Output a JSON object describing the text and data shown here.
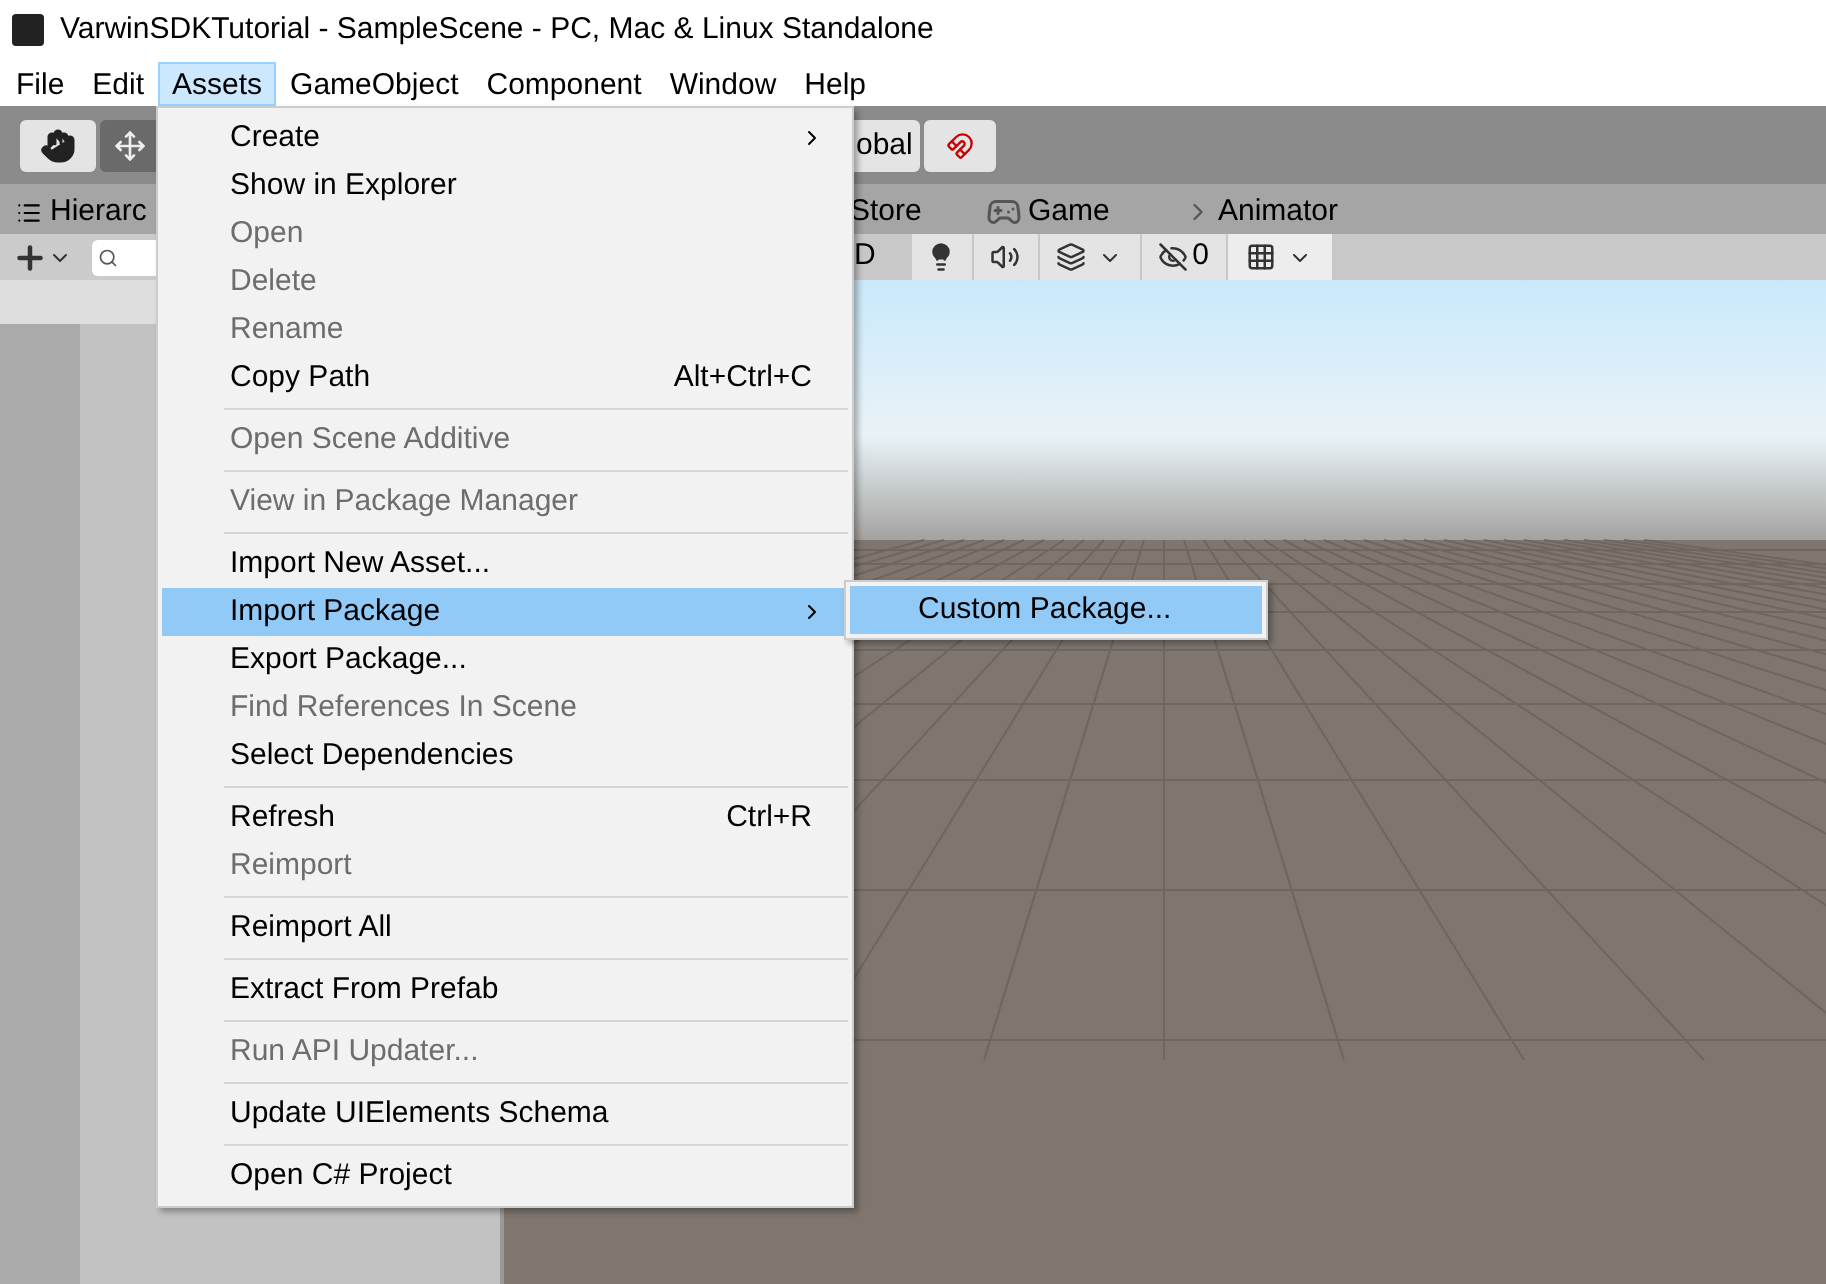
{
  "window": {
    "title": "VarwinSDKTutorial - SampleScene - PC, Mac & Linux Standalone"
  },
  "menubar": [
    {
      "label": "File",
      "selected": false
    },
    {
      "label": "Edit",
      "selected": false
    },
    {
      "label": "Assets",
      "selected": true
    },
    {
      "label": "GameObject",
      "selected": false
    },
    {
      "label": "Component",
      "selected": false
    },
    {
      "label": "Window",
      "selected": false
    },
    {
      "label": "Help",
      "selected": false
    }
  ],
  "toolbar": {
    "hand_selected": true,
    "global_label": "obal"
  },
  "tabs": [
    {
      "label": "Hierarc"
    },
    {
      "label": "Store"
    },
    {
      "label": "Game"
    },
    {
      "label": "Animator"
    }
  ],
  "scene_toolbar": {
    "mode_label": "D",
    "hidden_count": "0"
  },
  "menu": [
    {
      "kind": "item",
      "label": "Create",
      "disabled": false,
      "submenu": true,
      "selected": false
    },
    {
      "kind": "item",
      "label": "Show in Explorer",
      "disabled": false,
      "submenu": false,
      "selected": false
    },
    {
      "kind": "item",
      "label": "Open",
      "disabled": true,
      "submenu": false,
      "selected": false
    },
    {
      "kind": "item",
      "label": "Delete",
      "disabled": true,
      "submenu": false,
      "selected": false
    },
    {
      "kind": "item",
      "label": "Rename",
      "disabled": true,
      "submenu": false,
      "selected": false
    },
    {
      "kind": "item",
      "label": "Copy Path",
      "shortcut": "Alt+Ctrl+C",
      "disabled": false,
      "submenu": false,
      "selected": false
    },
    {
      "kind": "separator"
    },
    {
      "kind": "item",
      "label": "Open Scene Additive",
      "disabled": true,
      "submenu": false,
      "selected": false
    },
    {
      "kind": "separator"
    },
    {
      "kind": "item",
      "label": "View in Package Manager",
      "disabled": true,
      "submenu": false,
      "selected": false
    },
    {
      "kind": "separator"
    },
    {
      "kind": "item",
      "label": "Import New Asset...",
      "disabled": false,
      "submenu": false,
      "selected": false
    },
    {
      "kind": "item",
      "label": "Import Package",
      "disabled": false,
      "submenu": true,
      "selected": true
    },
    {
      "kind": "item",
      "label": "Export Package...",
      "disabled": false,
      "submenu": false,
      "selected": false
    },
    {
      "kind": "item",
      "label": "Find References In Scene",
      "disabled": true,
      "submenu": false,
      "selected": false
    },
    {
      "kind": "item",
      "label": "Select Dependencies",
      "disabled": false,
      "submenu": false,
      "selected": false
    },
    {
      "kind": "separator"
    },
    {
      "kind": "item",
      "label": "Refresh",
      "shortcut": "Ctrl+R",
      "disabled": false,
      "submenu": false,
      "selected": false
    },
    {
      "kind": "item",
      "label": "Reimport",
      "disabled": true,
      "submenu": false,
      "selected": false
    },
    {
      "kind": "separator"
    },
    {
      "kind": "item",
      "label": "Reimport All",
      "disabled": false,
      "submenu": false,
      "selected": false
    },
    {
      "kind": "separator"
    },
    {
      "kind": "item",
      "label": "Extract From Prefab",
      "disabled": false,
      "submenu": false,
      "selected": false
    },
    {
      "kind": "separator"
    },
    {
      "kind": "item",
      "label": "Run API Updater...",
      "disabled": true,
      "submenu": false,
      "selected": false
    },
    {
      "kind": "separator"
    },
    {
      "kind": "item",
      "label": "Update UIElements Schema",
      "disabled": false,
      "submenu": false,
      "selected": false
    },
    {
      "kind": "separator"
    },
    {
      "kind": "item",
      "label": "Open C# Project",
      "disabled": false,
      "submenu": false,
      "selected": false
    }
  ],
  "submenu": [
    {
      "label": "Custom Package...",
      "selected": true
    }
  ]
}
